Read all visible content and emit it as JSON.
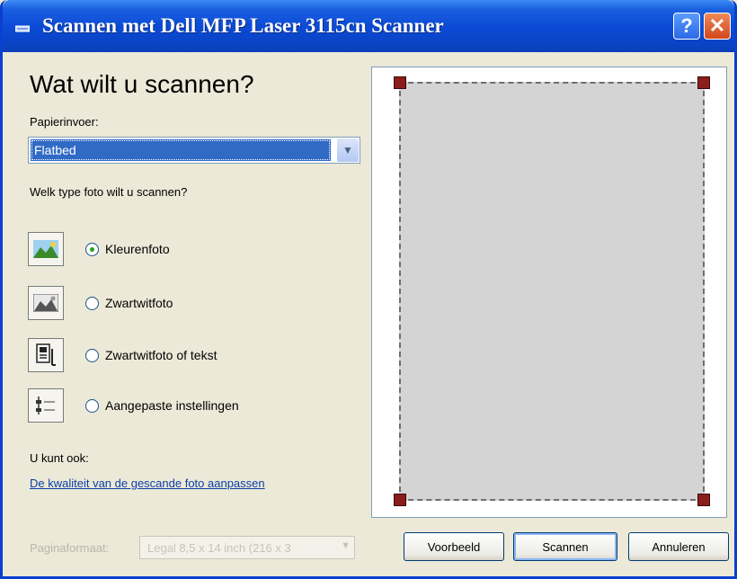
{
  "window": {
    "title": "Scannen met Dell MFP Laser 3115cn Scanner",
    "help_label": "?",
    "close_label": "✕"
  },
  "heading": "Wat wilt u scannen?",
  "paper_source": {
    "label": "Papierinvoer:",
    "value": "Flatbed"
  },
  "photo_type_prompt": "Welk type foto wilt u scannen?",
  "photo_types": [
    {
      "label": "Kleurenfoto",
      "selected": true,
      "icon": "color-photo-icon"
    },
    {
      "label": "Zwartwitfoto",
      "selected": false,
      "icon": "grayscale-photo-icon"
    },
    {
      "label": "Zwartwitfoto of tekst",
      "selected": false,
      "icon": "bw-text-icon"
    },
    {
      "label": "Aangepaste instellingen",
      "selected": false,
      "icon": "custom-settings-icon"
    }
  ],
  "also_label": "U kunt ook:",
  "quality_link": "De kwaliteit van de gescande foto aanpassen",
  "page_size": {
    "label": "Paginaformaat:",
    "value": "Legal 8,5 x 14 inch (216 x 3"
  },
  "buttons": {
    "preview": "Voorbeeld",
    "scan": "Scannen",
    "cancel": "Annuleren"
  },
  "colors": {
    "titlebar": "#0b4bd6",
    "selection": "#316ac5",
    "link": "#0b3fa8",
    "handle": "#8c1d1d"
  }
}
